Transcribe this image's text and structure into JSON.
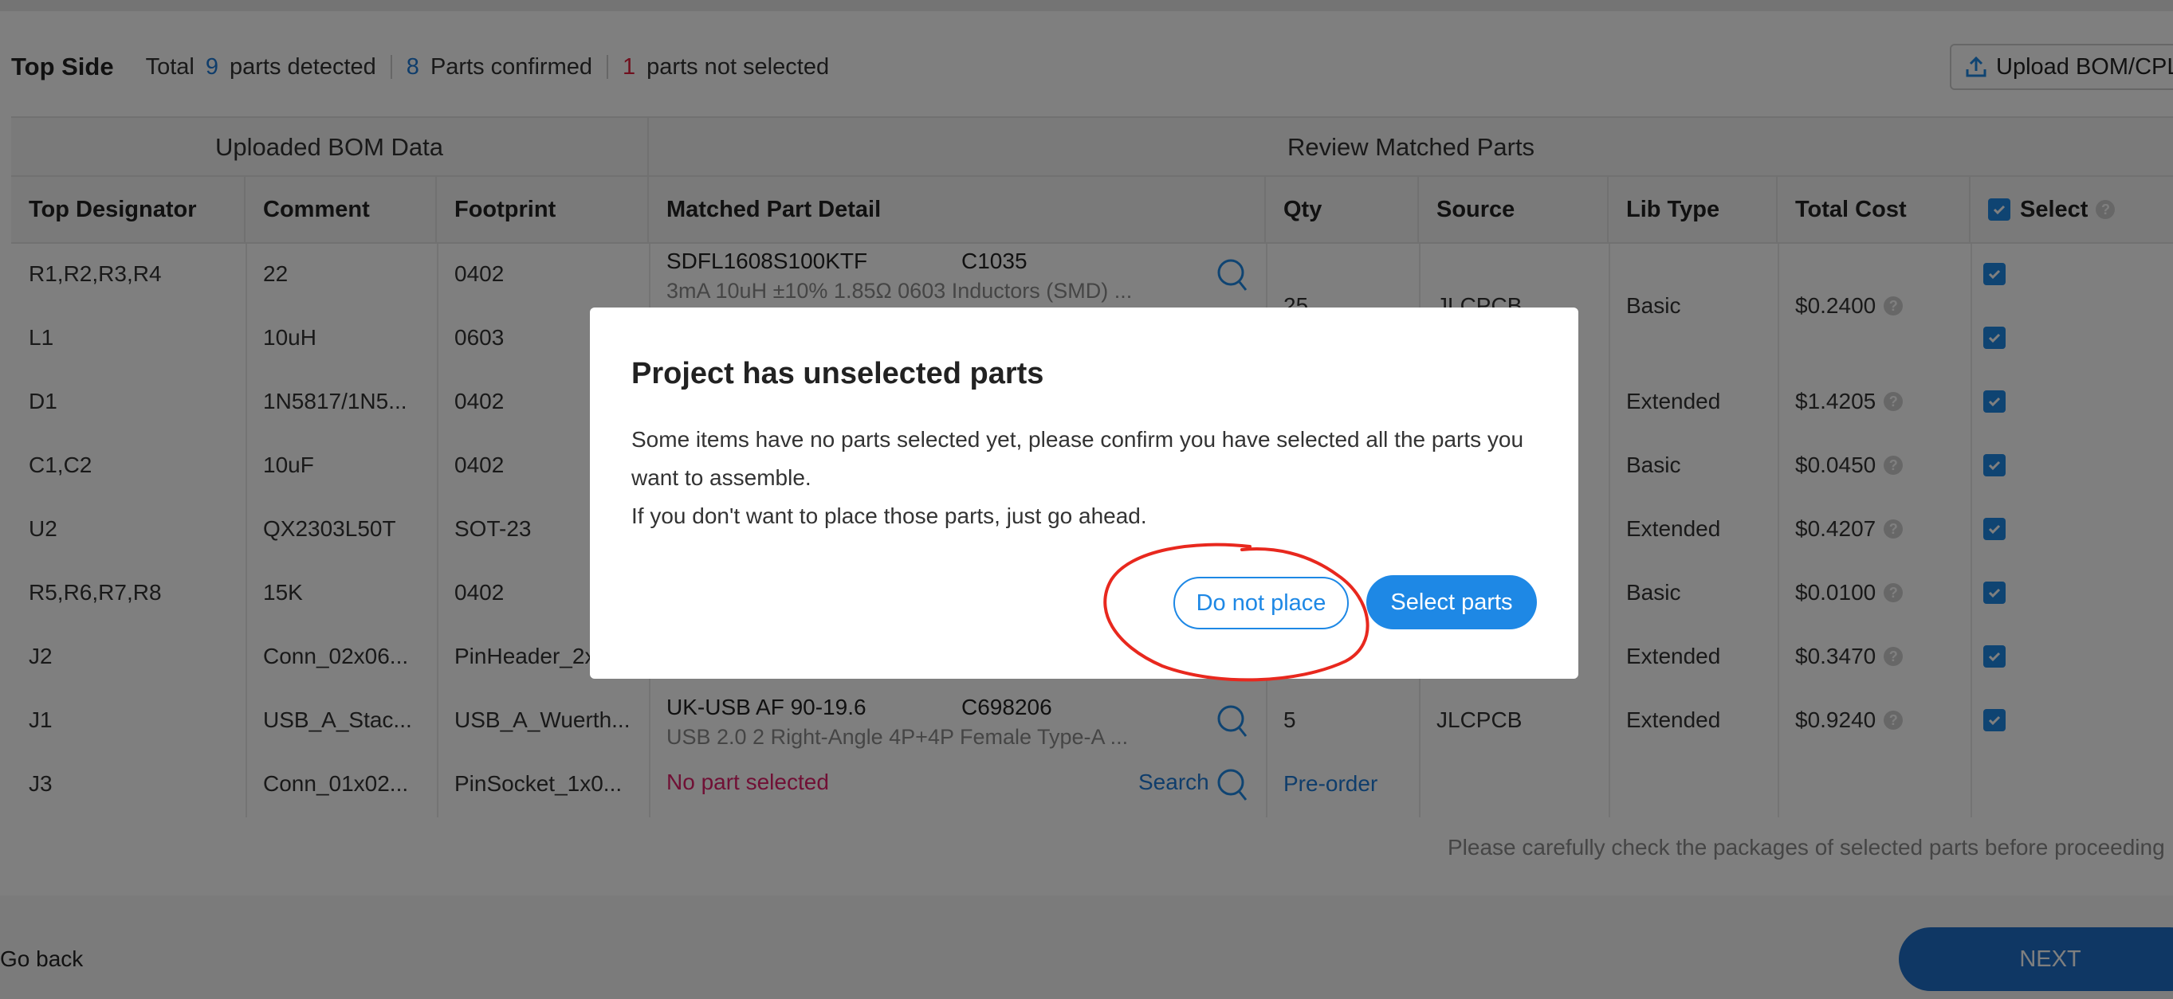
{
  "summary": {
    "side_title": "Top Side",
    "total_label": "Total",
    "total_count": "9",
    "detected_label": "parts detected",
    "confirmed_count": "8",
    "confirmed_label": "Parts confirmed",
    "not_selected_count": "1",
    "not_selected_label": "parts not selected",
    "upload_label": "Upload BOM/CPL",
    "upload_icon": "upload-icon"
  },
  "table": {
    "group_bom": "Uploaded BOM Data",
    "group_review": "Review Matched Parts",
    "headers": {
      "designator": "Top Designator",
      "comment": "Comment",
      "footprint": "Footprint",
      "detail": "Matched Part Detail",
      "qty": "Qty",
      "source": "Source",
      "lib_type": "Lib Type",
      "total_cost": "Total Cost",
      "select": "Select"
    },
    "rows": [
      {
        "designator": "R1,R2,R3,R4",
        "comment": "22",
        "footprint": "0402",
        "part": "SDFL1608S100KTF",
        "code": "C1035",
        "desc": "3mA 10uH ±10% 1.85Ω 0603 Inductors (SMD) ...",
        "qty": "25",
        "source": "JLCPCB",
        "lib": "Basic",
        "cost": "$0.2400",
        "selected": true
      },
      {
        "designator": "L1",
        "comment": "10uH",
        "footprint": "0603",
        "selected": true
      },
      {
        "designator": "D1",
        "comment": "1N5817/1N5...",
        "footprint": "0402",
        "lib": "Extended",
        "cost": "$1.4205",
        "selected": true
      },
      {
        "designator": "C1,C2",
        "comment": "10uF",
        "footprint": "0402",
        "lib": "Basic",
        "cost": "$0.0450",
        "selected": true
      },
      {
        "designator": "U2",
        "comment": "QX2303L50T",
        "footprint": "SOT-23",
        "lib": "Extended",
        "cost": "$0.4207",
        "selected": true
      },
      {
        "designator": "R5,R6,R7,R8",
        "comment": "15K",
        "footprint": "0402",
        "lib": "Basic",
        "cost": "$0.0100",
        "selected": true
      },
      {
        "designator": "J2",
        "comment": "Conn_02x06...",
        "footprint": "PinHeader_2x...",
        "lib": "Extended",
        "cost": "$0.3470",
        "selected": true
      },
      {
        "designator": "J1",
        "comment": "USB_A_Stac...",
        "footprint": "USB_A_Wuerth...",
        "part": "UK-USB AF 90-19.6",
        "code": "C698206",
        "desc": "USB 2.0 2 Right-Angle 4P+4P Female Type-A ...",
        "qty": "5",
        "source": "JLCPCB",
        "lib": "Extended",
        "cost": "$0.9240",
        "selected": true
      },
      {
        "designator": "J3",
        "comment": "Conn_01x02...",
        "footprint": "PinSocket_1x0...",
        "no_part": "No part selected",
        "search_label": "Search",
        "qty": "Pre-order",
        "selected": false
      }
    ],
    "note": "Please carefully check the packages of selected parts before proceeding"
  },
  "footer": {
    "go_back": "Go back",
    "next": "NEXT"
  },
  "modal": {
    "title": "Project has unselected parts",
    "line1": "Some items have no parts selected yet, please confirm you have selected all the parts you want to assemble.",
    "line2": "If you don't want to place those parts, just go ahead.",
    "do_not_place": "Do not place",
    "select_parts": "Select parts"
  },
  "colors": {
    "accent": "#1e88e5",
    "red_count": "#e0203c",
    "annotation": "#e8281e"
  }
}
